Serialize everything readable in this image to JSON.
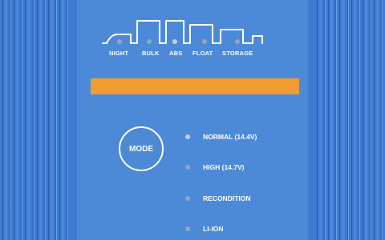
{
  "colors": {
    "background": "#3f7bd0",
    "panel": "#4c8ad8",
    "display_bar": "#f39c32",
    "led_off": "#9aa6b4",
    "led_on": "#b9d3ef",
    "text": "#ffffff"
  },
  "icons": {
    "phase_graph": "charge-curve-icon"
  },
  "stages": [
    {
      "label": "NIGHT",
      "active": false
    },
    {
      "label": "BULK",
      "active": false
    },
    {
      "label": "ABS",
      "active": true
    },
    {
      "label": "FLOAT",
      "active": false
    },
    {
      "label": "STORAGE",
      "active": false
    }
  ],
  "mode_button": {
    "label": "MODE"
  },
  "modes": [
    {
      "label": "NORMAL (14.4V)",
      "active": true
    },
    {
      "label": "HIGH (14.7V)",
      "active": false
    },
    {
      "label": "RECONDITION",
      "active": false
    },
    {
      "label": "LI-ION",
      "active": false
    }
  ]
}
